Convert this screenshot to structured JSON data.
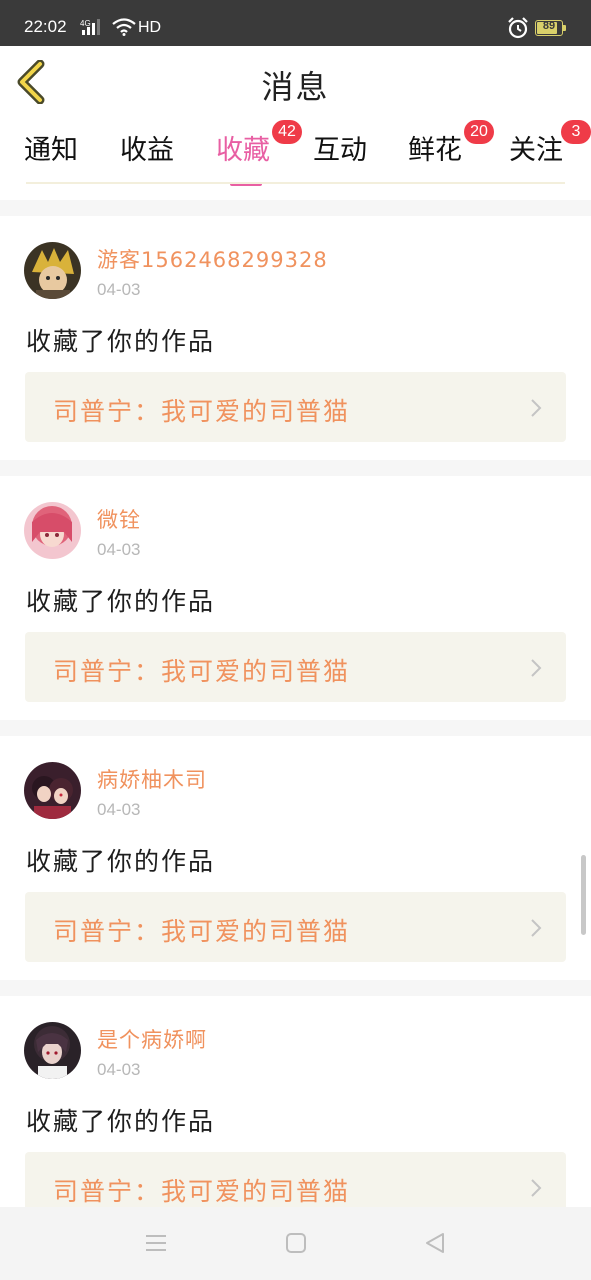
{
  "status_bar": {
    "time": "22:02",
    "network": "4G",
    "hd": "HD",
    "battery_level": "89",
    "battery_fraction": 0.89
  },
  "header": {
    "title": "消息",
    "back_icon": "chevron-left-icon"
  },
  "tabs": [
    {
      "label": "通知",
      "active": false,
      "badge": ""
    },
    {
      "label": "收益",
      "active": false,
      "badge": ""
    },
    {
      "label": "收藏",
      "active": true,
      "badge": "42"
    },
    {
      "label": "互动",
      "active": false,
      "badge": ""
    },
    {
      "label": "鲜花",
      "active": false,
      "badge": "20"
    },
    {
      "label": "关注",
      "active": false,
      "badge": "3"
    }
  ],
  "colors": {
    "accent": "#e85fa3",
    "name": "#f0925e",
    "badge": "#ef3b48",
    "work_bg": "#f5f4ec"
  },
  "messages": [
    {
      "user": "游客1562468299328",
      "date": "04-03",
      "action": "收藏了你的作品",
      "work": "司普宁：我可爱的司普猫",
      "avatar": "avatar-1"
    },
    {
      "user": "微铨",
      "date": "04-03",
      "action": "收藏了你的作品",
      "work": "司普宁：我可爱的司普猫",
      "avatar": "avatar-2"
    },
    {
      "user": "病娇柚木司",
      "date": "04-03",
      "action": "收藏了你的作品",
      "work": "司普宁：我可爱的司普猫",
      "avatar": "avatar-3"
    },
    {
      "user": "是个病娇啊",
      "date": "04-03",
      "action": "收藏了你的作品",
      "work": "司普宁：我可爱的司普猫",
      "avatar": "avatar-4"
    }
  ],
  "nav": {
    "menu_icon": "menu-icon",
    "home_icon": "home-square-icon",
    "back_icon": "back-triangle-icon"
  }
}
